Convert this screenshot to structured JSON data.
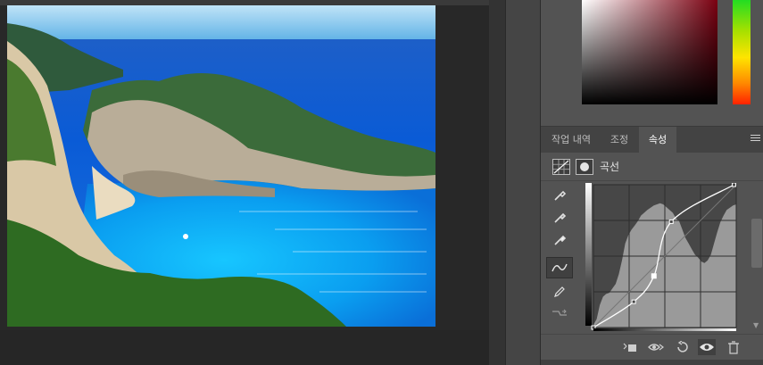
{
  "document": {
    "image_desc": "photo"
  },
  "colors": {
    "panel_bg": "#535353",
    "tab_bar_bg": "#434343",
    "canvas_bg": "#282828",
    "curve": "#ffffff",
    "histogram": "#9a9a9a"
  },
  "panel": {
    "tabs": [
      {
        "label": "작업 내역",
        "active": false
      },
      {
        "label": "조정",
        "active": false
      },
      {
        "label": "속성",
        "active": true
      }
    ],
    "properties_title": "곡선"
  },
  "tools": [
    {
      "icon": "eyedropper-sample-icon"
    },
    {
      "icon": "eyedropper-gray-icon"
    },
    {
      "icon": "eyedropper-white-icon"
    },
    {
      "icon": "curve-point-icon",
      "active": true
    },
    {
      "icon": "pencil-icon"
    },
    {
      "icon": "smooth-icon"
    }
  ],
  "curve": {
    "input_range": [
      0,
      255
    ],
    "output_range": [
      0,
      255
    ],
    "points": [
      {
        "input": 0,
        "output": 0
      },
      {
        "input": 72,
        "output": 46
      },
      {
        "input": 108,
        "output": 92
      },
      {
        "input": 139,
        "output": 189
      },
      {
        "input": 251,
        "output": 255
      }
    ],
    "histogram": [
      5,
      15,
      40,
      55,
      60,
      62,
      70,
      78,
      95,
      120,
      150,
      165,
      175,
      182,
      190,
      200,
      205,
      210,
      214,
      218,
      220,
      222,
      220,
      215,
      210,
      205,
      195,
      190,
      175,
      160,
      150,
      140,
      130,
      125,
      118,
      115,
      120,
      130,
      150,
      170,
      188,
      200,
      210,
      214,
      218,
      220
    ]
  },
  "bottom_bar_icons": [
    "clip-to-layer-icon",
    "view-previous-icon",
    "reset-icon",
    "visibility-eye-icon",
    "trash-icon"
  ]
}
